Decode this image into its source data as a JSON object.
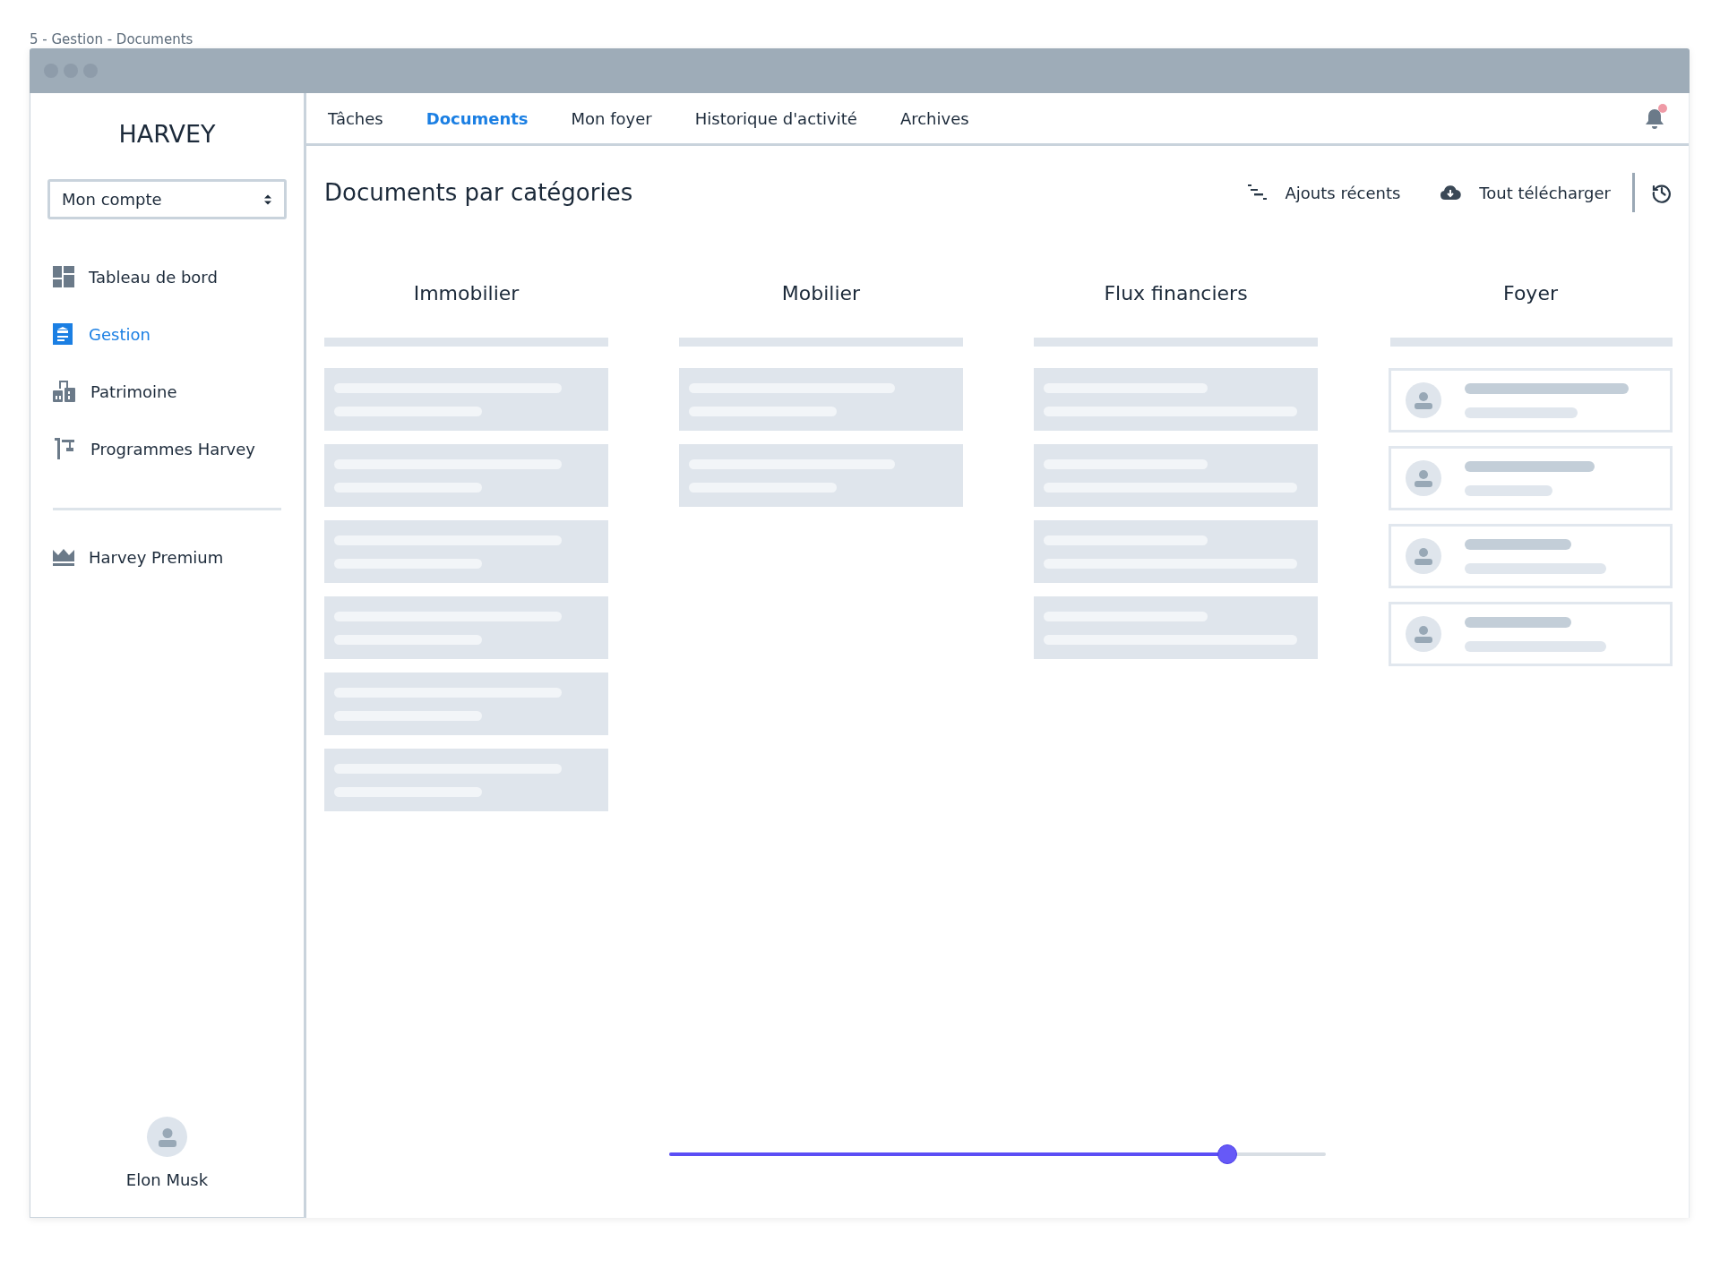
{
  "caption": "5 - Gestion - Documents",
  "sidebar": {
    "brand": "HARVEY",
    "account_select": {
      "value": "Mon compte"
    },
    "items": [
      {
        "label": "Tableau de bord",
        "selected": false
      },
      {
        "label": "Gestion",
        "selected": true
      },
      {
        "label": "Patrimoine",
        "selected": false
      },
      {
        "label": "Programmes Harvey",
        "selected": false
      }
    ],
    "premium": {
      "label": "Harvey Premium"
    },
    "user": {
      "name": "Elon Musk"
    }
  },
  "tabs": [
    {
      "label": "Tâches",
      "selected": false
    },
    {
      "label": "Documents",
      "selected": true
    },
    {
      "label": "Mon foyer",
      "selected": false
    },
    {
      "label": "Historique d'activité",
      "selected": false
    },
    {
      "label": "Archives",
      "selected": false
    }
  ],
  "notifications": {
    "unread": true
  },
  "header": {
    "title": "Documents par catégories",
    "actions": [
      {
        "label": "Ajouts récents"
      },
      {
        "label": "Tout télécharger"
      }
    ]
  },
  "columns": [
    {
      "title": "Immobilier",
      "cards": [
        {
          "kind": "skeleton"
        },
        {
          "kind": "skeleton"
        },
        {
          "kind": "skeleton"
        },
        {
          "kind": "skeleton"
        },
        {
          "kind": "skeleton"
        },
        {
          "kind": "skeleton"
        }
      ]
    },
    {
      "title": "Mobilier",
      "cards": [
        {
          "kind": "skeleton"
        },
        {
          "kind": "skeleton"
        }
      ]
    },
    {
      "title": "Flux financiers",
      "cards": [
        {
          "kind": "skeleton"
        },
        {
          "kind": "skeleton"
        },
        {
          "kind": "skeleton"
        },
        {
          "kind": "skeleton"
        }
      ]
    },
    {
      "title": "Foyer",
      "cards": [
        {
          "kind": "person"
        },
        {
          "kind": "person"
        },
        {
          "kind": "person"
        },
        {
          "kind": "person"
        }
      ]
    }
  ],
  "slider": {
    "level": 0.85
  }
}
